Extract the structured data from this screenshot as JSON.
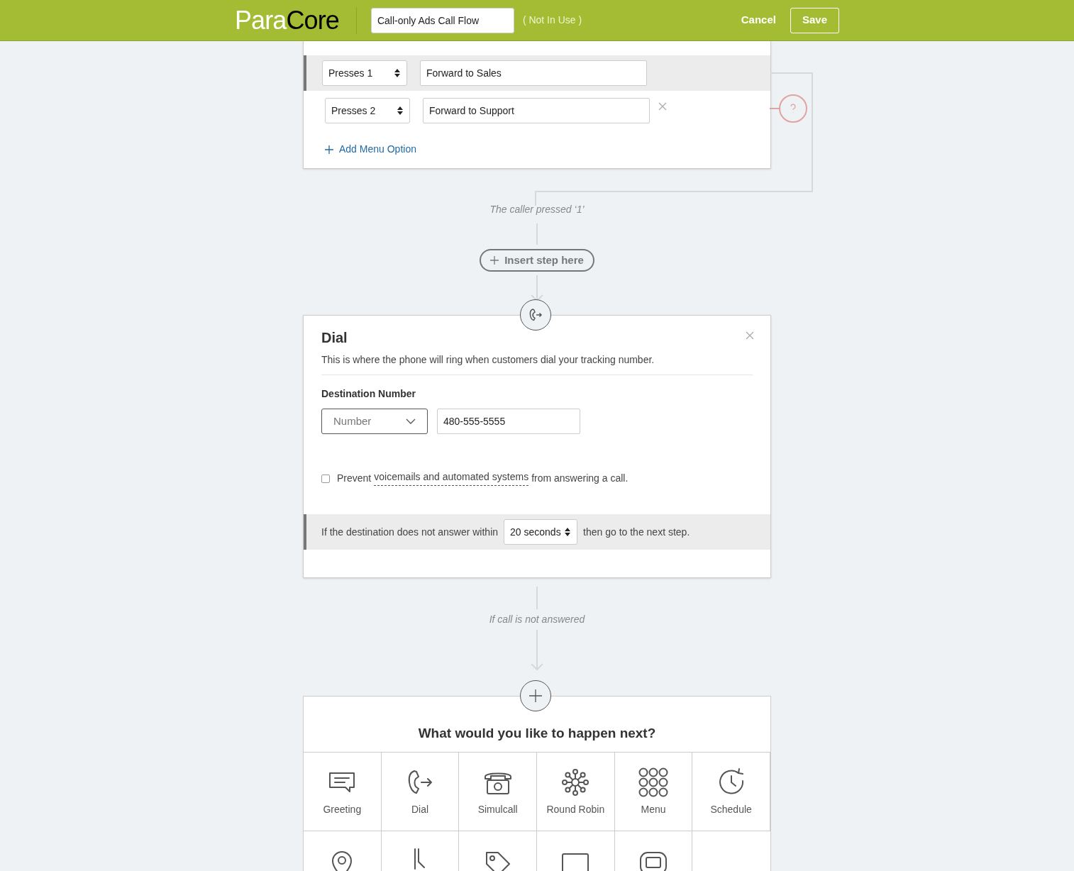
{
  "header": {
    "logo_left": "Para",
    "logo_right": "Core",
    "flow_name": "Call-only Ads Call Flow",
    "status": "( Not In Use )",
    "cancel": "Cancel",
    "save": "Save"
  },
  "menu_step": {
    "options": [
      {
        "key": "Presses 1",
        "action": "Forward to Sales",
        "selected": true,
        "removable": false
      },
      {
        "key": "Presses 2",
        "action": "Forward to Support",
        "selected": false,
        "removable": true
      }
    ],
    "add_option": "Add Menu Option"
  },
  "branch_label": "The caller pressed ‘1’",
  "insert_step": "Insert step here",
  "dial_step": {
    "title": "Dial",
    "description": "This is where the phone will ring when customers dial your tracking number.",
    "destination_label": "Destination Number",
    "type": "Number",
    "number": "480-555-5555",
    "prevent": {
      "checked": false,
      "before": "Prevent",
      "link": "voicemails and automated systems",
      "after": "from answering a call."
    },
    "timeout": {
      "before": "If the destination does not answer within",
      "value": "20 seconds",
      "after": "then go to the next step."
    }
  },
  "unanswered_label": "If call is not answered",
  "next_step": {
    "title": "What would you like to happen next?",
    "options": [
      {
        "kind": "greeting",
        "label": "Greeting"
      },
      {
        "kind": "dial",
        "label": "Dial"
      },
      {
        "kind": "simulcall",
        "label": "Simulcall"
      },
      {
        "kind": "round_robin",
        "label": "Round Robin"
      },
      {
        "kind": "menu",
        "label": "Menu"
      },
      {
        "kind": "schedule",
        "label": "Schedule"
      }
    ],
    "more_options": [
      {
        "kind": "location"
      },
      {
        "kind": "split"
      },
      {
        "kind": "tag"
      },
      {
        "kind": "screen"
      },
      {
        "kind": "message"
      },
      {
        "kind": "empty"
      }
    ]
  }
}
